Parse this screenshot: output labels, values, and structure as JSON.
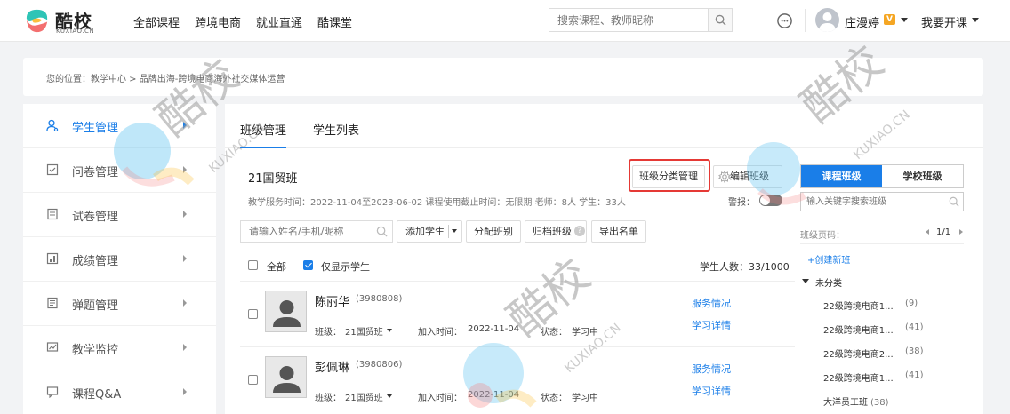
{
  "brand": {
    "name": "酷校",
    "sub": "KUXIAO.CN"
  },
  "nav": [
    "全部课程",
    "跨境电商",
    "就业直通",
    "酷课堂"
  ],
  "search": {
    "placeholder": "搜索课程、教师昵称"
  },
  "user": {
    "name": "庄漫婷",
    "vip": "V",
    "teach_label": "我要开课"
  },
  "breadcrumb": "您的位置：教学中心 > 品牌出海-跨境电商海外社交媒体运营",
  "sidebar": {
    "items": [
      {
        "label": "学生管理",
        "icon": "student-icon",
        "active": true
      },
      {
        "label": "问卷管理",
        "icon": "survey-icon"
      },
      {
        "label": "试卷管理",
        "icon": "exam-icon"
      },
      {
        "label": "成绩管理",
        "icon": "grade-icon"
      },
      {
        "label": "弹题管理",
        "icon": "quiz-icon"
      },
      {
        "label": "教学监控",
        "icon": "monitor-icon"
      },
      {
        "label": "课程Q&A",
        "icon": "qa-icon"
      }
    ]
  },
  "tabs": [
    "班级管理",
    "学生列表"
  ],
  "class": {
    "name": "21国贸班",
    "info": "教学服务时间：2022-11-04至2023-06-02 课程使用截止时间：无限期 老师：8人 学生：33人",
    "category_button": "班级分类管理",
    "edit_button": "编辑班级",
    "alarm_label": "警报："
  },
  "toolbar": {
    "search_placeholder": "请输入姓名/手机/昵称",
    "add_student": "添加学生",
    "assign_class": "分配班别",
    "archive_class": "归档班级",
    "export_list": "导出名单"
  },
  "filter": {
    "all": "全部",
    "only_show": "仅显示学生",
    "count": "学生人数：33/1000"
  },
  "students": [
    {
      "name": "陈丽华",
      "id": "(3980808)",
      "class_label": "班级：",
      "class": "21国贸班",
      "join_label": "加入时间：",
      "join": "2022-11-04",
      "status_label": "状态：",
      "status": "学习中",
      "link1": "服务情况",
      "link2": "学习详情"
    },
    {
      "name": "彭佩琳",
      "id": "(3980806)",
      "class_label": "班级：",
      "class": "21国贸班",
      "join_label": "加入时间：",
      "join": "2022-11-04",
      "status_label": "状态：",
      "status": "学习中",
      "link1": "服务情况",
      "link2": "学习详情"
    }
  ],
  "class_panel": {
    "tab_course": "课程班级",
    "tab_school": "学校班级",
    "search_placeholder": "输入关键字搜索班级",
    "pager_label": "班级页码：",
    "pager": "1/1",
    "create": "+创建新班",
    "uncategorized": "未分类",
    "items": [
      {
        "label": "22级跨境电商1...",
        "count": "(9)"
      },
      {
        "label": "22级跨境电商1...",
        "count": "(41)"
      },
      {
        "label": "22级跨境电商2...",
        "count": "(38)"
      },
      {
        "label": "22级跨境电商1...",
        "count": "(41)"
      },
      {
        "label": "大洋员工班",
        "count": "(38)"
      }
    ]
  },
  "watermark": "酷校",
  "watermark_sub": "KUXIAO.CN",
  "colors": {
    "accent": "#1a7ee8",
    "highlight": "#e53935",
    "vip": "#f5a623"
  }
}
